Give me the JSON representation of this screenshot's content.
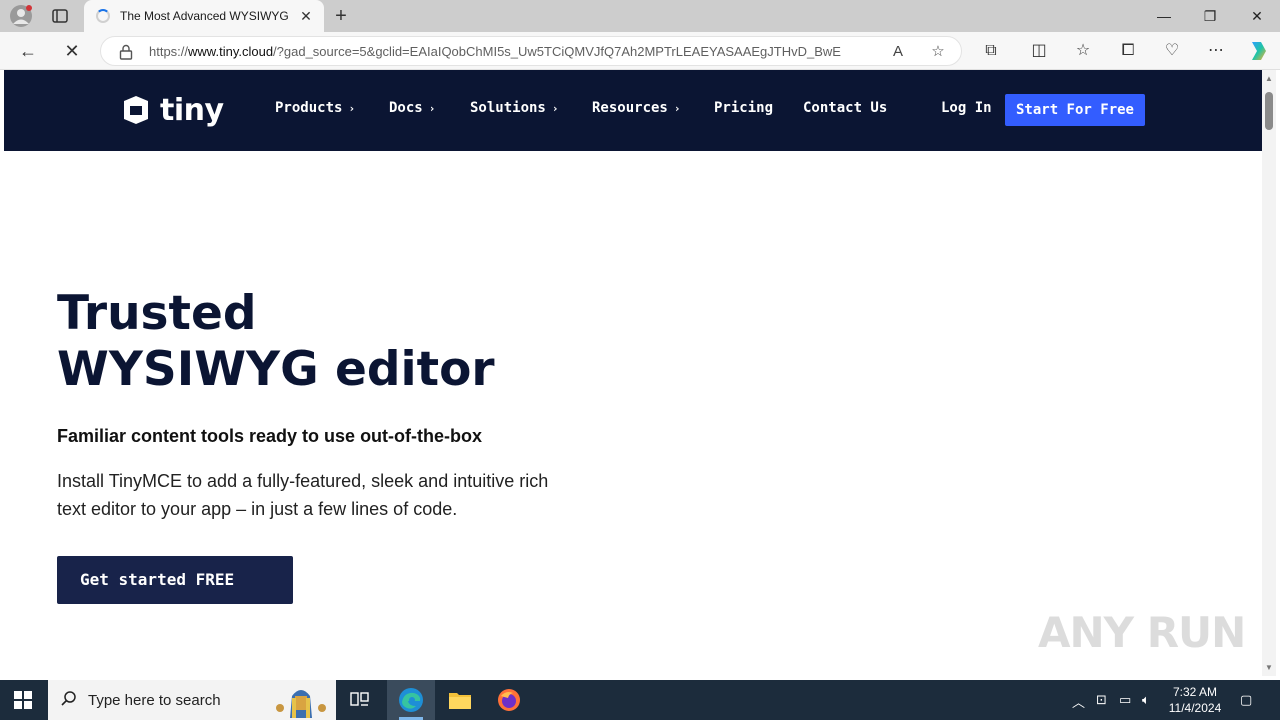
{
  "browser": {
    "tab_title": "The Most Advanced WYSIWYG Ed",
    "url_prefix": "https://",
    "url_domain": "www.tiny.cloud",
    "url_rest": "/?gad_source=5&gclid=EAIaIQobChMI5s_Uw5TCiQMVJfQ7Ah2MPTrLEAEYASAAEgJTHvD_BwE"
  },
  "site": {
    "logo_text": "tiny",
    "nav": {
      "products": "Products",
      "docs": "Docs",
      "solutions": "Solutions",
      "resources": "Resources",
      "pricing": "Pricing",
      "contact": "Contact Us",
      "login": "Log In",
      "start_free": "Start For Free"
    },
    "hero": {
      "title_line1": "Trusted",
      "title_line2": "WYSIWYG editor",
      "subtitle": "Familiar content tools ready to use out-of-the-box",
      "description": "Install TinyMCE to add a fully-featured, sleek and intuitive rich text editor to your app – in just a few lines of code.",
      "cta": "Get started FREE"
    },
    "brand_color": "#0b1533",
    "accent_color": "#335dff"
  },
  "watermark": "ANY RUN",
  "taskbar": {
    "search_placeholder": "Type here to search",
    "time": "7:32 AM",
    "date": "11/4/2024"
  }
}
